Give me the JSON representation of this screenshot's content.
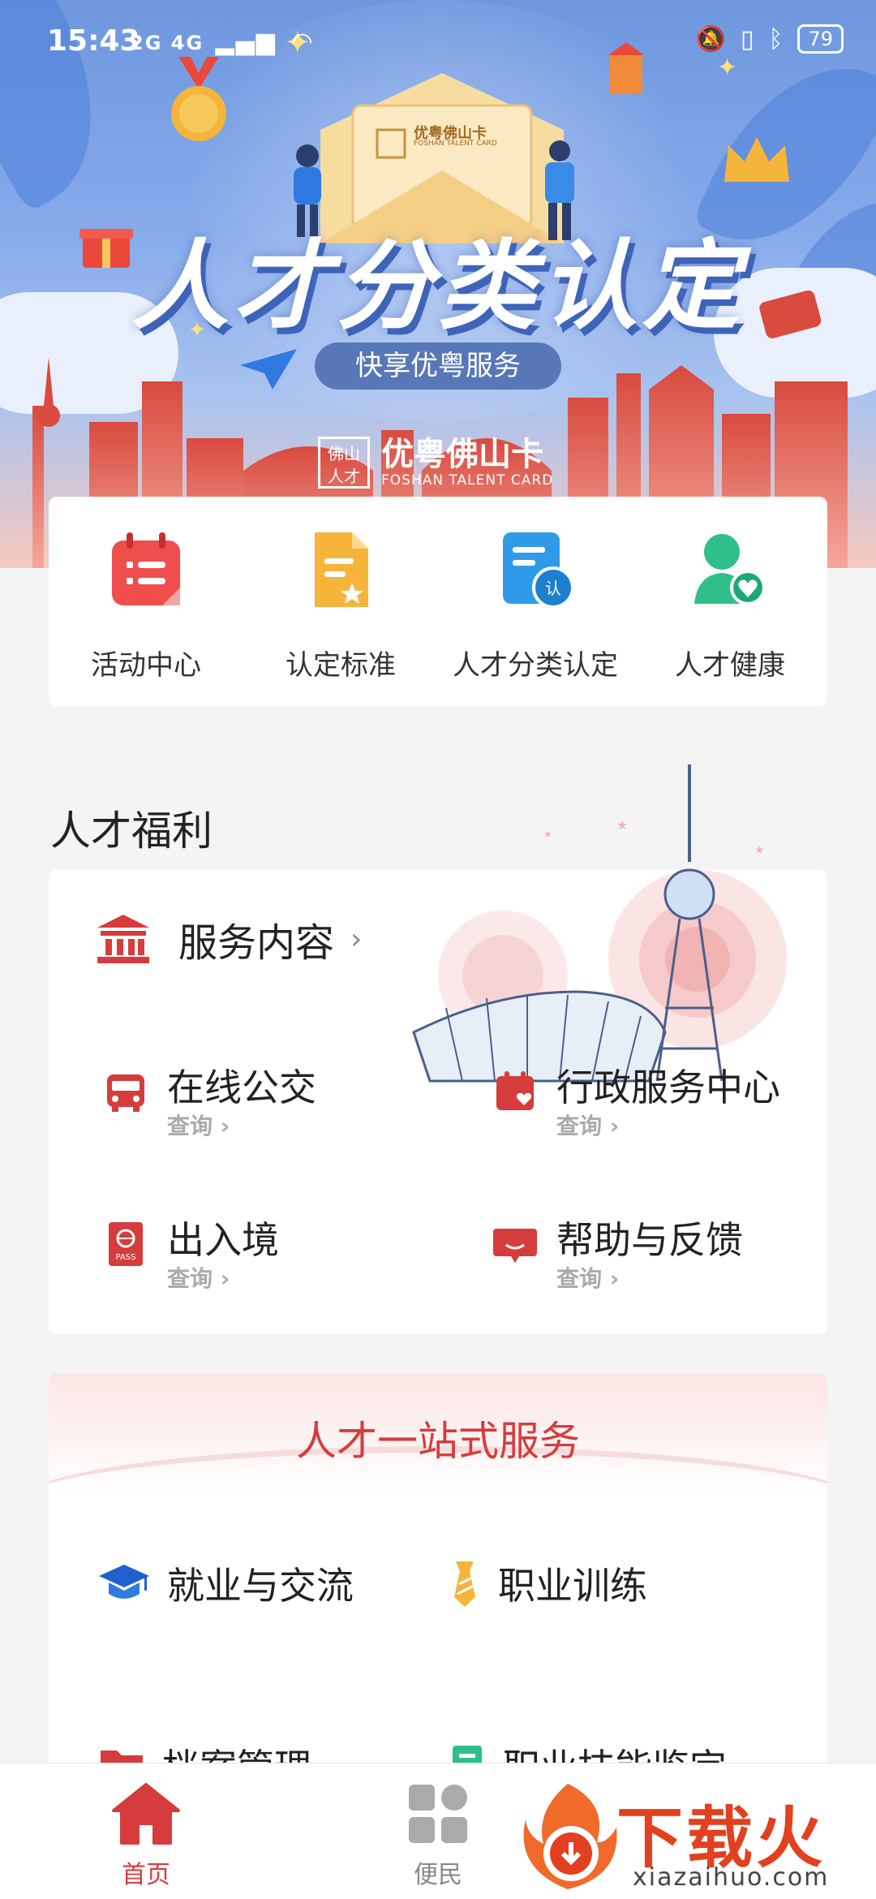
{
  "status_bar": {
    "time": "15:43",
    "network": "2G 4G",
    "battery": "79"
  },
  "banner": {
    "card_name": "优粤佛山卡",
    "card_name_en": "FOSHAN TALENT CARD",
    "title": "人才分类认定",
    "pill": "快享优粤服务",
    "seal_text": "佛山人才",
    "brand_cn": "优粤佛山卡",
    "brand_en": "FOSHAN TALENT CARD"
  },
  "quick_menu": [
    {
      "label": "活动中心",
      "icon": "calendar-list-icon",
      "color": "#f04d4d"
    },
    {
      "label": "认定标准",
      "icon": "document-star-icon",
      "color": "#f5b53b"
    },
    {
      "label": "人才分类认定",
      "icon": "certify-doc-icon",
      "color": "#2f9be8"
    },
    {
      "label": "人才健康",
      "icon": "person-heart-icon",
      "color": "#2fbf8b"
    }
  ],
  "benefits": {
    "section_title": "人才福利",
    "service": {
      "title": "服务内容",
      "chevron": "›"
    },
    "items": [
      {
        "name": "在线公交",
        "sub": "查询 ›",
        "icon": "bus-icon"
      },
      {
        "name": "行政服务中心",
        "sub": "查询 ›",
        "icon": "calendar-heart-icon"
      },
      {
        "name": "出入境",
        "sub": "查询 ›",
        "icon": "passport-icon",
        "badge": "PASS"
      },
      {
        "name": "帮助与反馈",
        "sub": "查询 ›",
        "icon": "feedback-icon"
      }
    ]
  },
  "one_stop": {
    "title": "人才一站式服务",
    "items": [
      {
        "name": "就业与交流",
        "icon": "graduation-cap-icon"
      },
      {
        "name": "职业训练",
        "icon": "tie-icon"
      },
      {
        "name": "档案管理",
        "icon": "folder-icon"
      },
      {
        "name": "职业技能鉴定",
        "icon": "certificate-icon"
      }
    ]
  },
  "tabbar": {
    "tabs": [
      {
        "label": "首页",
        "active": true
      },
      {
        "label": "便民",
        "active": false
      }
    ],
    "active_color": "#d63c3c",
    "inactive_color": "#888888"
  },
  "watermark": {
    "text": "下载火",
    "url": "xiazaihuo.com"
  }
}
